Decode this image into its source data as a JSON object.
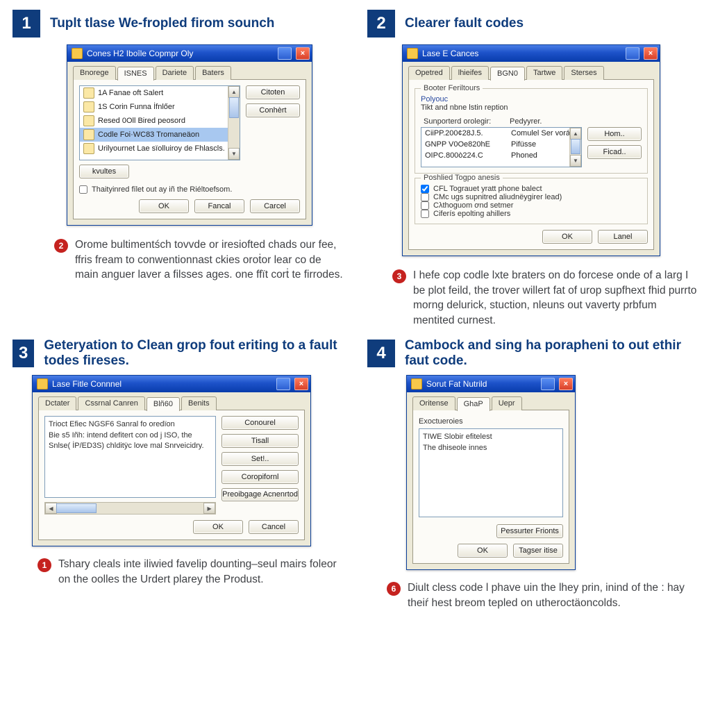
{
  "steps": {
    "s1": {
      "num": "1",
      "title": "Tuplt tlase We-fropled firom sounch"
    },
    "s2": {
      "num": "2",
      "title": "Clearer fault codes"
    },
    "s3": {
      "num": "3",
      "title": "Geteryation to Clean grop fout eriting to a fault todes fireses."
    },
    "s4": {
      "num": "4",
      "title": "Cambock and sing ha porapheni to out ethir faut code."
    }
  },
  "captions": {
    "c2": {
      "badge": "2",
      "text": "Orome bultimentśch tovvde or iresiofted chads our fee, ffris fream to conwentionnast ckies oroṫor lear co de main anguer laver a filsses ages. one ffït corṫ te firrodes."
    },
    "c3": {
      "badge": "3",
      "text": "I hefe cop codle lxte braters on do forcese onde of a larg I be plot feild, the trover willert fat of urop supfhext fhid purrto morng delurick, stuction, nleuns out vaverty prbfum mentited curnest."
    },
    "c1": {
      "badge": "1",
      "text": "Tshary cleals inte iliwied favelip dounting–seul mairs foleor on the oolles the Urdert plarey the Produst."
    },
    "c6": {
      "badge": "6",
      "text": "Diult cless code l phave uin the lhey prin, inind of the : hay theiŕ hest breom tepled on utheroctäoncolds."
    }
  },
  "win1": {
    "title": "Cones H2 Iboîle Copmpr Oly",
    "tabs": [
      "Bnorege",
      "ISNES",
      "Dariete",
      "Baters"
    ],
    "list": [
      "1A Fanae oft Salert",
      "1S Corin Funna İfnlőer",
      "Resed 0Oll Bired peosord",
      "Codle Foi·WC83 Tromaneäon",
      "Urilyournet Lae sïolluiroy de Fhlascls."
    ],
    "sideBtns": [
      "Citoten",
      "Conhèrt"
    ],
    "bottomBtn": "kvultes",
    "chk": "Thaityinred fīlet out ay iñ the Riéltoefsom.",
    "ok": "OK",
    "fancal": "Fancal",
    "cancel": "Carcel"
  },
  "win2": {
    "title": "Lase E Cances",
    "tabs": [
      "Opetred",
      "lhieifes",
      "BGN0",
      "Tartwe",
      "Sterses"
    ],
    "legend": "Booter Feriltours",
    "polyLabel": "Polyouc",
    "polyText": "Tikt and nbne lstin reption",
    "colA": "Sunporterd orolegir:",
    "colB": "Pedyyrer.",
    "rows": [
      {
        "a": "CiiPP.200¢28J.5.",
        "b": "Comulel Ser vorágt"
      },
      {
        "a": "GNPP V0Oe820hE",
        "b": "Pifüsse"
      },
      {
        "a": "OIPC.800ò224.C",
        "b": "Phoned"
      }
    ],
    "sideBtns": [
      "Hom..",
      "Ficad.."
    ],
    "grp2": "Poshlied Togpo anesis",
    "checks": [
      "CFL Tograuet yratt phone balect",
      "CMc ugs supnitred aliudnëygirer lead)",
      "Cλthoguom ơnd setmer",
      "Ciferís epolting ahillers"
    ],
    "ok": "OK",
    "lanel": "Lanel"
  },
  "win3": {
    "title": "Lase Fitle Connnel",
    "tabs": [
      "Dctater",
      "Cssrnal Canren",
      "Blñ60",
      "Benits"
    ],
    "body": [
      "Trioct Efiec NGSF6 Sanral fo oredïon",
      "Bie s5 Iñh: intend defitert con od j ISO, the",
      "Snlse( İP/ED3S) chlditÿc love mal Snrveicidry."
    ],
    "sideBtns": [
      "Conourel",
      "Tisall",
      "Set!..",
      "Coropifornl",
      "Preoibgage Acnenrtod"
    ],
    "ok": "OK",
    "cancel": "Cancel"
  },
  "win4": {
    "title": "Sorut Fat Nutrild",
    "tabs": [
      "Oritense",
      "GhaP",
      "Uepr"
    ],
    "legend": "Exoctueroies",
    "body": [
      "TIWE Slobir efitelest",
      "The dhiseole innes"
    ],
    "btn2": "Pessurter Frionts",
    "ok": "OK",
    "tag": "Tagser itise"
  }
}
